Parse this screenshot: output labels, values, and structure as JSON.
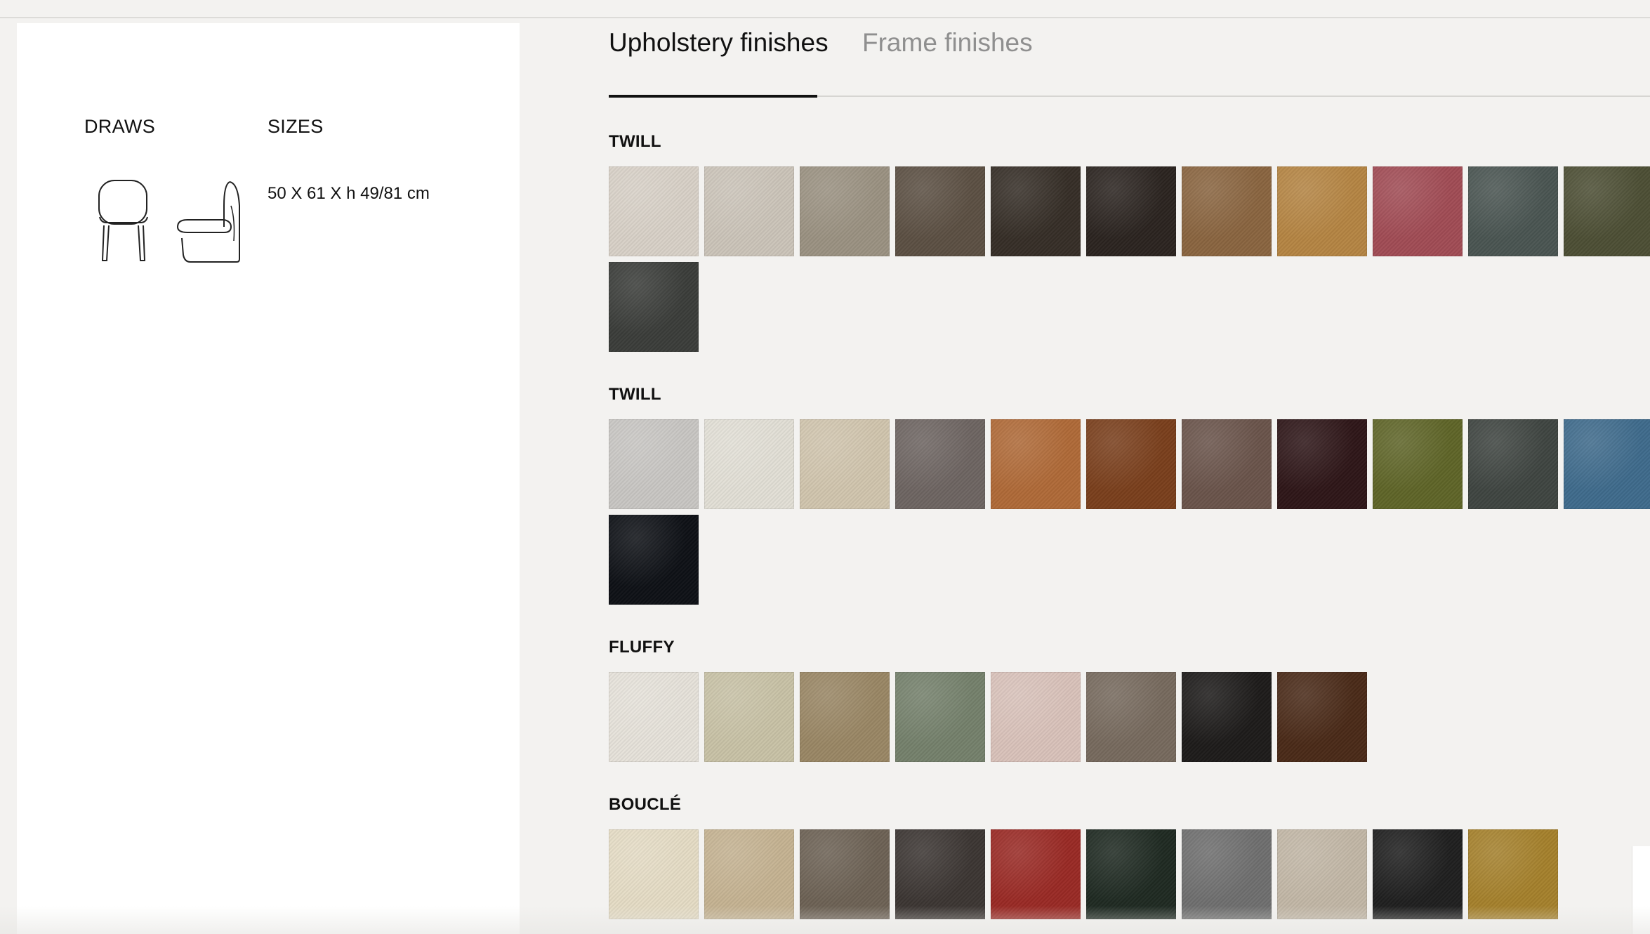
{
  "draws": {
    "title": "DRAWS"
  },
  "sizes": {
    "title": "SIZES",
    "value": "50 X 61 X h 49/81 cm"
  },
  "tabs": [
    {
      "label": "Upholstery finishes",
      "active": true
    },
    {
      "label": "Frame finishes",
      "active": false
    }
  ],
  "sections": [
    {
      "title": "TWILL",
      "swatches": [
        "#d8d1c7",
        "#cbc4b9",
        "#9b9282",
        "#5c5043",
        "#362e27",
        "#2b2420",
        "#8a6540",
        "#b58543",
        "#a14c55",
        "#4a5552",
        "#4d4f35",
        "#3b3d3a"
      ]
    },
    {
      "title": "TWILL",
      "swatches": [
        "#c8c6c3",
        "#e2dfd6",
        "#d1c5ae",
        "#6e6562",
        "#b06a38",
        "#7a3f1c",
        "#6a544b",
        "#2e1618",
        "#5f6528",
        "#3f4541",
        "#3f6b8c",
        "#0e1116"
      ]
    },
    {
      "title": "FLUFFY",
      "swatches": [
        "#e6e2da",
        "#c8c2a6",
        "#9a8765",
        "#75816c",
        "#d9c2ba",
        "#776a5e",
        "#1d1b1a",
        "#4a2a18"
      ]
    },
    {
      "title": "BOUCLÉ",
      "swatches": [
        "#e5dcc5",
        "#c5b392",
        "#6d6255",
        "#3c3633",
        "#9a2a25",
        "#1f2a22",
        "#6f6f6f",
        "#c2b7a6",
        "#1f1f1f",
        "#a5812c"
      ]
    }
  ]
}
